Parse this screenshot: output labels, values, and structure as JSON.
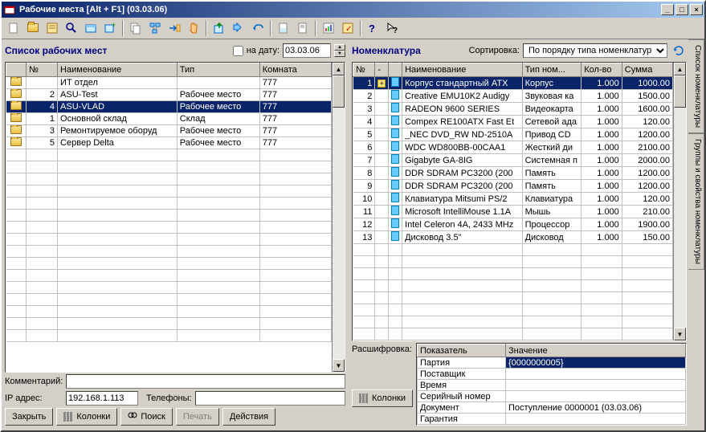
{
  "titlebar": "Рабочие места [Alt + F1] (03.03.06)",
  "left": {
    "title": "Список рабочих мест",
    "date_checkbox_label": "на дату:",
    "date_value": "03.03.06",
    "columns": {
      "num": "№",
      "name": "Наименование",
      "type": "Тип",
      "room": "Комната"
    },
    "rows": [
      {
        "num": "",
        "name": "ИТ отдел",
        "type": "",
        "room": "777",
        "icon": "folder"
      },
      {
        "num": "2",
        "name": "ASU-Test",
        "type": "Рабочее место",
        "room": "777",
        "icon": "folder"
      },
      {
        "num": "4",
        "name": "ASU-VLAD",
        "type": "Рабочее место",
        "room": "777",
        "icon": "folder",
        "selected": true
      },
      {
        "num": "1",
        "name": "Основной склад",
        "type": "Склад",
        "room": "777",
        "icon": "folder"
      },
      {
        "num": "3",
        "name": "Ремонтируемое оборуд",
        "type": "Рабочее место",
        "room": "777",
        "icon": "folder"
      },
      {
        "num": "5",
        "name": "Сервер Delta",
        "type": "Рабочее место",
        "room": "777",
        "icon": "folder"
      }
    ],
    "comment_label": "Комментарий:",
    "comment_value": "",
    "ip_label": "IP адрес:",
    "ip_value": "192.168.1.113",
    "phone_label": "Телефоны:",
    "phone_value": "",
    "buttons": {
      "close": "Закрыть",
      "columns": "Колонки",
      "search": "Поиск",
      "print": "Печать",
      "actions": "Действия"
    }
  },
  "right": {
    "title": "Номенклатура",
    "sort_label": "Сортировка:",
    "sort_value": "По порядку типа номенклатуры",
    "columns": {
      "num": "№",
      "dash": "-",
      "name": "Наименование",
      "type": "Тип ном...",
      "qty": "Кол-во",
      "sum": "Сумма"
    },
    "rows": [
      {
        "num": "1",
        "name": "Корпус стандартный ATX",
        "type": "Корпус",
        "qty": "1.000",
        "sum": "1000.00",
        "selected": true,
        "plus": true
      },
      {
        "num": "2",
        "name": "Creative EMU10K2 Audigy",
        "type": "Звуковая ка",
        "qty": "1.000",
        "sum": "1500.00"
      },
      {
        "num": "3",
        "name": "RADEON 9600 SERIES",
        "type": "Видеокарта",
        "qty": "1.000",
        "sum": "1600.00"
      },
      {
        "num": "4",
        "name": "Compex RE100ATX Fast Et",
        "type": "Сетевой ада",
        "qty": "1.000",
        "sum": "120.00"
      },
      {
        "num": "5",
        "name": "_NEC DVD_RW ND-2510A",
        "type": "Привод CD",
        "qty": "1.000",
        "sum": "1200.00"
      },
      {
        "num": "6",
        "name": "WDC WD800BB-00CAA1",
        "type": "Жесткий ди",
        "qty": "1.000",
        "sum": "2100.00"
      },
      {
        "num": "7",
        "name": "Gigabyte GA-8IG",
        "type": "Системная п",
        "qty": "1.000",
        "sum": "2000.00"
      },
      {
        "num": "8",
        "name": "DDR SDRAM PC3200 (200",
        "type": "Память",
        "qty": "1.000",
        "sum": "1200.00"
      },
      {
        "num": "9",
        "name": "DDR SDRAM PC3200 (200",
        "type": "Память",
        "qty": "1.000",
        "sum": "1200.00"
      },
      {
        "num": "10",
        "name": "Клавиатура Mitsumi PS/2",
        "type": "Клавиатура",
        "qty": "1.000",
        "sum": "120.00"
      },
      {
        "num": "11",
        "name": "Microsoft IntelliMouse 1.1A",
        "type": "Мышь",
        "qty": "1.000",
        "sum": "210.00"
      },
      {
        "num": "12",
        "name": "Intel Celeron 4A, 2433 MHz",
        "type": "Процессор",
        "qty": "1.000",
        "sum": "1900.00"
      },
      {
        "num": "13",
        "name": "Дисковод 3.5''",
        "type": "Дисковод",
        "qty": "1.000",
        "sum": "150.00"
      }
    ],
    "detail_label": "Расшифровка:",
    "detail_columns": {
      "indicator": "Показатель",
      "value": "Значение"
    },
    "details": [
      {
        "ind": "Партия",
        "val": "{0000000005}",
        "selected": true
      },
      {
        "ind": "Поставщик",
        "val": ""
      },
      {
        "ind": "Время",
        "val": ""
      },
      {
        "ind": "Серийный номер",
        "val": ""
      },
      {
        "ind": "Документ",
        "val": "Поступление 0000001 (03.03.06)"
      },
      {
        "ind": "Гарантия",
        "val": ""
      }
    ],
    "columns_btn": "Колонки"
  },
  "side_tabs": {
    "tab1": "Список номенклатуры",
    "tab2": "Группы и свойства номенклатуры"
  }
}
